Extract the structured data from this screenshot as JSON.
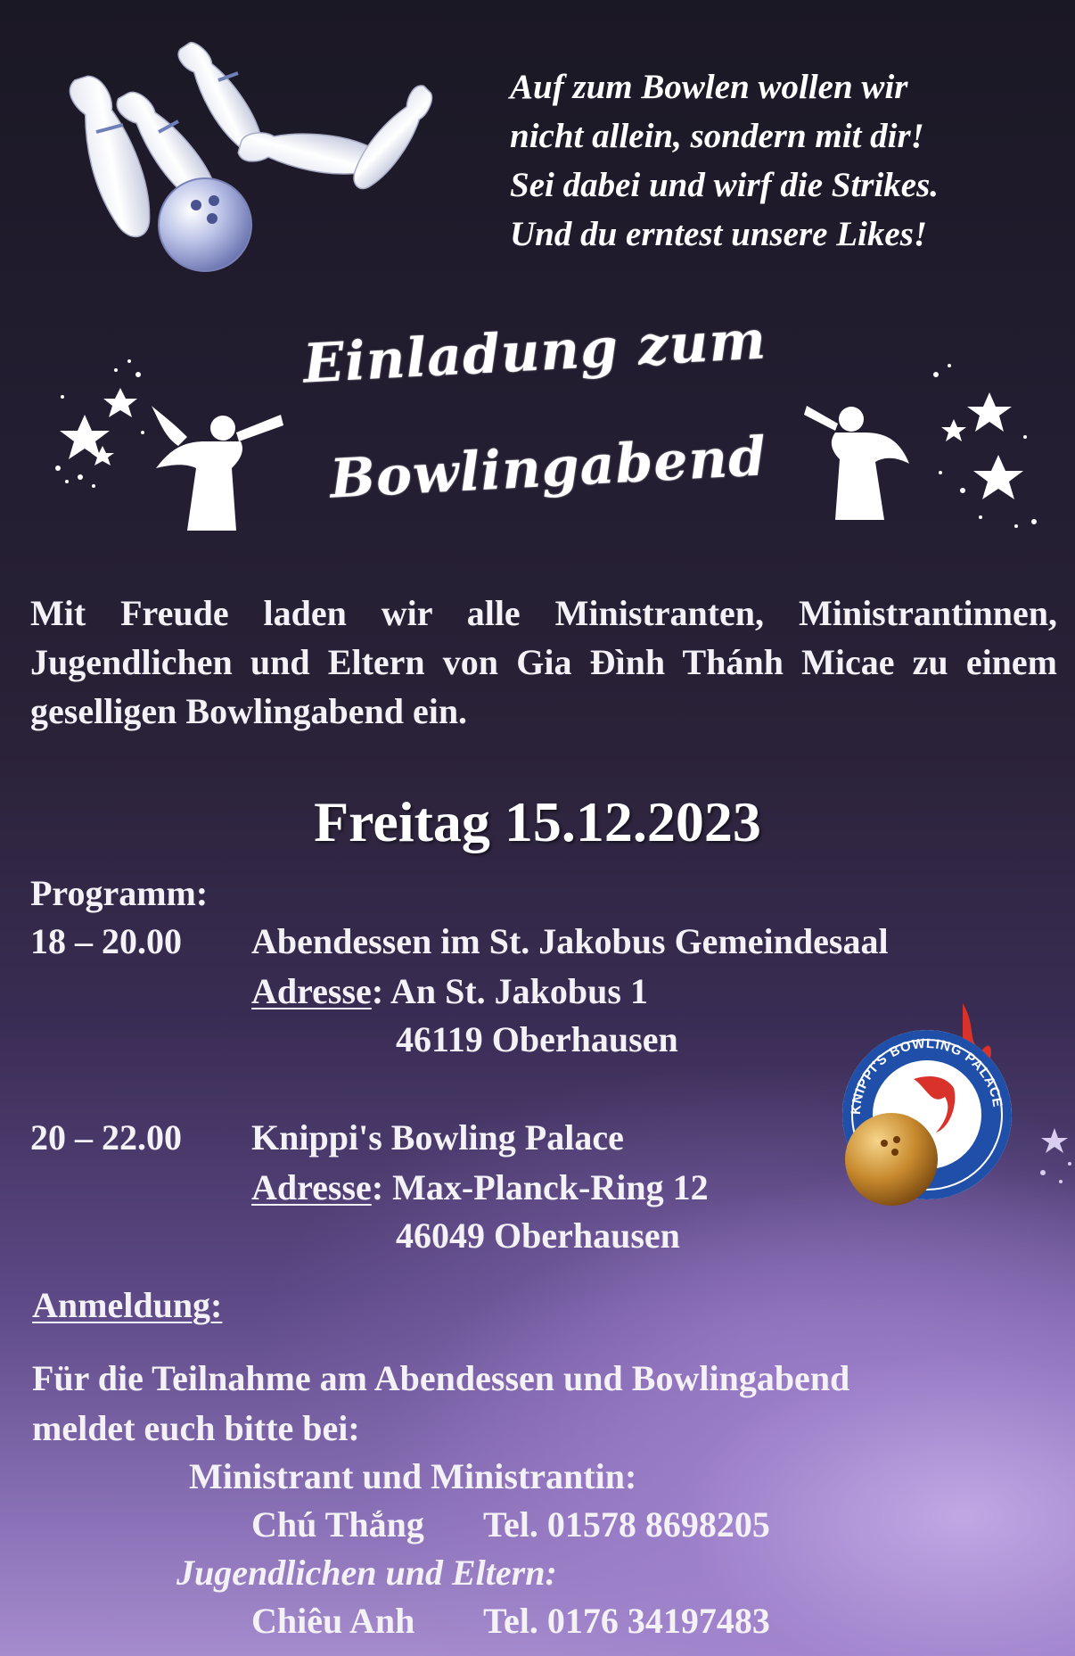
{
  "poem": [
    "Auf zum Bowlen wollen wir",
    "nicht allein, sondern mit dir!",
    "Sei dabei und wirf die Strikes.",
    "Und du erntest unsere Likes!"
  ],
  "title": {
    "line1": "Einladung zum",
    "line2": "Bowlingabend"
  },
  "intro": "Mit Freude laden wir alle Ministranten, Ministrantinnen, Jugendlichen und Eltern von Gia Đình Thánh Micae zu einem geselligen Bowlingabend ein.",
  "date": "Freitag 15.12.2023",
  "program": {
    "heading": "Programm:",
    "items": [
      {
        "time": "18 – 20.00",
        "title": "Abendessen im St. Jakobus Gemeindesaal",
        "address_label": "Adresse",
        "address_line1": "An St. Jakobus 1",
        "address_line2": "46119 Oberhausen"
      },
      {
        "time": "20 – 22.00",
        "title": "Knippi's Bowling Palace",
        "address_label": "Adresse",
        "address_line1": "Max-Planck-Ring 12",
        "address_line2": "46049 Oberhausen"
      }
    ]
  },
  "registration": {
    "heading": "Anmeldung:",
    "text_line1": "Für die Teilnahme am Abendessen und Bowlingabend",
    "text_line2": "meldet euch bitte bei:",
    "contacts": [
      {
        "group": "Ministrant und Ministrantin:",
        "name": "Chú Thắng",
        "phone": "Tel.  01578 8698205"
      },
      {
        "group": "Jugendlichen und Eltern:",
        "name": "Chiêu Anh",
        "phone": "Tel. 0176 34197483"
      }
    ]
  },
  "logo": {
    "text": "KNIPPI'S BOWLING PALACE"
  },
  "icons": [
    "bowling-pins-icon",
    "bowling-ball-icon",
    "angel-trumpet-icon",
    "stars-icon"
  ],
  "colors": {
    "background_top": "#1b1825",
    "background_bottom": "#a58ccd",
    "text": "#f4f1f7",
    "logo_blue": "#1f4fa8",
    "logo_red": "#d8322a"
  }
}
